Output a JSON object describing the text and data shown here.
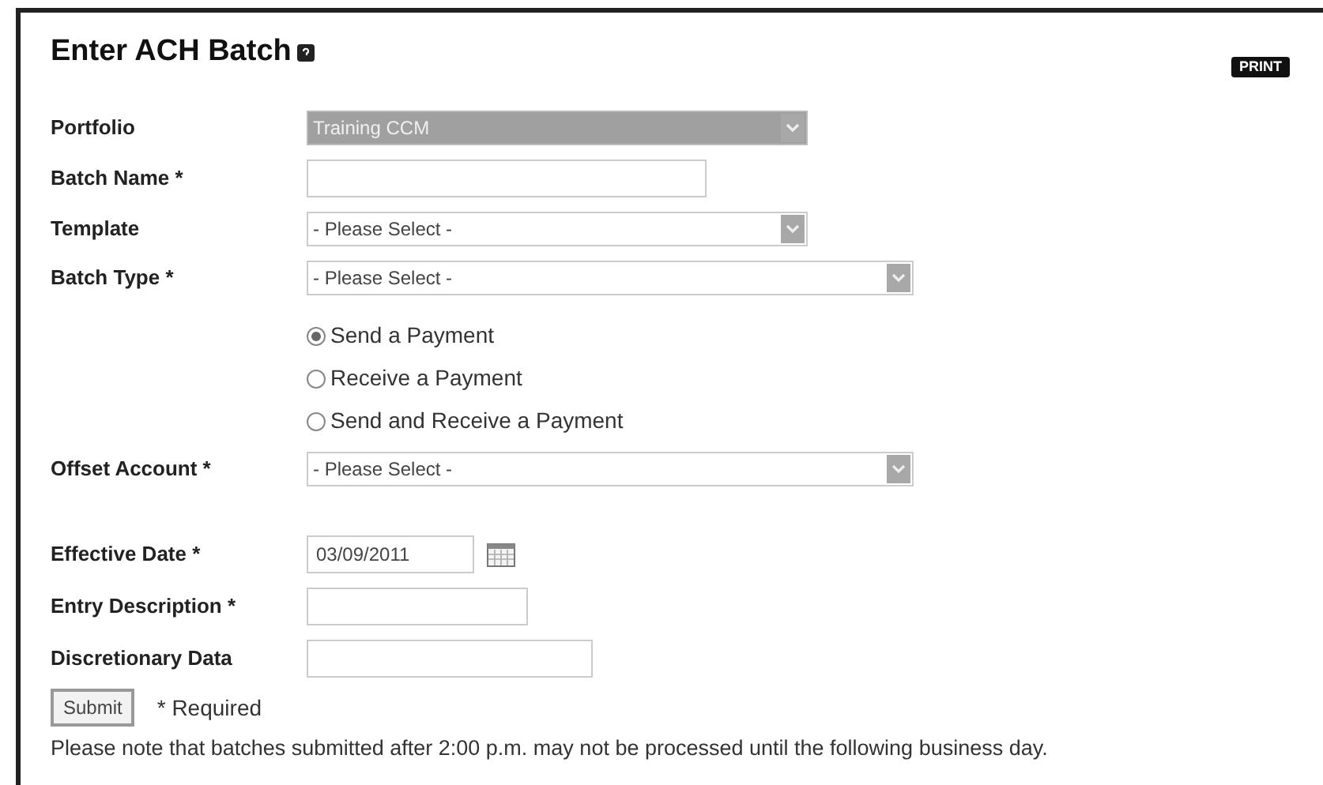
{
  "page": {
    "title": "Enter ACH Batch",
    "print_label": "PRINT"
  },
  "fields": [
    {
      "kind": "select",
      "label": "Portfolio",
      "value": "Training CCM",
      "disabled": true
    },
    {
      "kind": "text",
      "label": "Batch Name *"
    },
    {
      "kind": "select",
      "label": "Template",
      "value": "- Please Select -",
      "disabled": false
    },
    {
      "kind": "select",
      "label": "Batch Type *",
      "value": "- Please Select -",
      "disabled": false
    },
    {
      "kind": "radios",
      "options": [
        {
          "label": "Send a Payment",
          "selected": true
        },
        {
          "label": "Receive a Payment",
          "selected": false
        },
        {
          "label": "Send and Receive a Payment",
          "selected": false
        }
      ]
    },
    {
      "kind": "select",
      "label": "Offset Account *",
      "value": "- Please Select -",
      "disabled": false
    },
    {
      "kind": "date",
      "label": "Effective Date *",
      "value": "03/09/2011"
    },
    {
      "kind": "text",
      "label": "Entry Description *"
    },
    {
      "kind": "text",
      "label": "Discretionary Data"
    }
  ],
  "submit_label": "Submit",
  "required_note": "* Required",
  "notice": "Please note that batches submitted after 2:00 p.m. may not be processed until the following business day."
}
